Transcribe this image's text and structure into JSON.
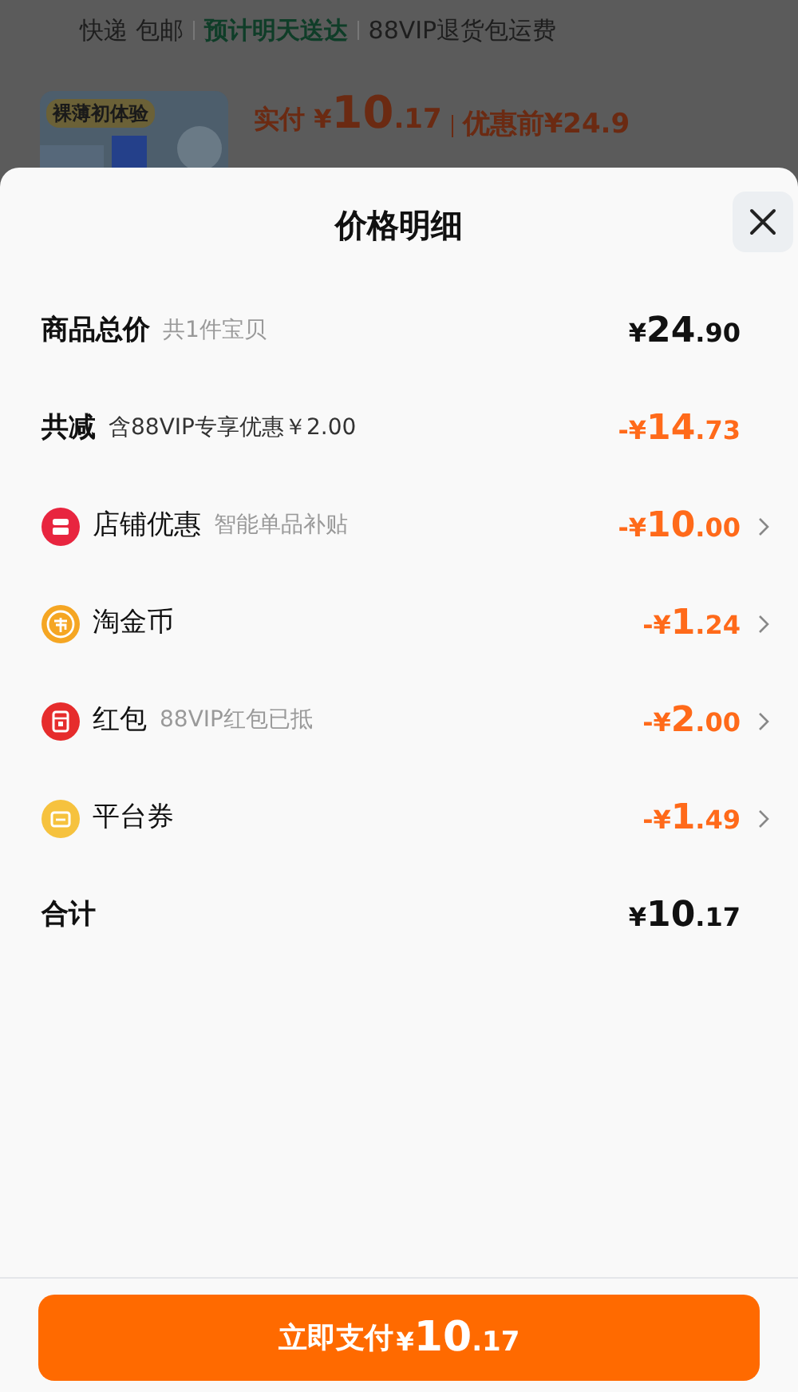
{
  "background_page": {
    "shipping": [
      {
        "text": "快递 包邮",
        "kind": "plain"
      },
      {
        "text": "预计明天送达",
        "kind": "highlight"
      },
      {
        "text": "88VIP退货包运费",
        "kind": "plain"
      }
    ],
    "product": {
      "badge": "裸薄初体验",
      "price_label": "实付",
      "price": {
        "currency": "¥",
        "int": "10",
        "dec": ".17"
      },
      "original_price": "优惠前¥24.9"
    }
  },
  "sheet": {
    "title": "价格明细",
    "rows": [
      {
        "kind": "summary",
        "label": "商品总价",
        "note": "共1件宝贝",
        "amount": {
          "prefix": "¥",
          "int": "24",
          "dec": ".90"
        },
        "discount": false,
        "chevron": false
      },
      {
        "kind": "summary",
        "label": "共减",
        "note": "含88VIP专享优惠￥2.00",
        "amount": {
          "prefix": "-¥",
          "int": "14",
          "dec": ".73"
        },
        "discount": true,
        "chevron": false
      },
      {
        "kind": "shop",
        "label": "店铺优惠",
        "note": "智能单品补贴",
        "amount": {
          "prefix": "-¥",
          "int": "10",
          "dec": ".00"
        },
        "discount": true,
        "chevron": true
      },
      {
        "kind": "coin",
        "label": "淘金币",
        "amount": {
          "prefix": "-¥",
          "int": "1",
          "dec": ".24"
        },
        "discount": true,
        "chevron": true
      },
      {
        "kind": "redpacket",
        "label": "红包",
        "note": "88VIP红包已抵",
        "amount": {
          "prefix": "-¥",
          "int": "2",
          "dec": ".00"
        },
        "discount": true,
        "chevron": true
      },
      {
        "kind": "coupon",
        "label": "平台券",
        "amount": {
          "prefix": "-¥",
          "int": "1",
          "dec": ".49"
        },
        "discount": true,
        "chevron": true
      },
      {
        "kind": "total",
        "label": "合计",
        "amount": {
          "prefix": "¥",
          "int": "10",
          "dec": ".17"
        },
        "discount": false,
        "chevron": false
      }
    ],
    "pay_button": {
      "label": "立即支付",
      "amount": {
        "prefix": "¥",
        "int": "10",
        "dec": ".17"
      }
    }
  }
}
